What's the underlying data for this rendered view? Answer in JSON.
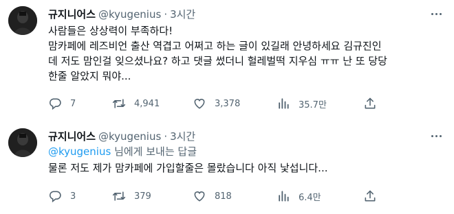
{
  "tweets": [
    {
      "name": "규지니어스",
      "handle": "@kyugenius",
      "sep": "·",
      "time": "3시간",
      "lines": [
        "사람들은 상상력이 부족하다!",
        "맘카페에 레즈비언 출산 역겹고 어쩌고 하는 글이 있길래 안녕하세요 김규진인",
        "데 저도 맘인걸 잊으셨나요? 하고 댓글 썼더니 헐레벌떡 지우심 ㅠㅠ 난 또 당당",
        "한줄 알았지 뭐야..."
      ],
      "replies": "7",
      "retweets": "4,941",
      "likes": "3,378",
      "views": "35.7만"
    },
    {
      "name": "규지니어스",
      "handle": "@kyugenius",
      "sep": "·",
      "time": "3시간",
      "reply_mention": "@kyugenius",
      "reply_suffix": " 님에게 보내는 답글",
      "lines": [
        "물론 저도 제가 맘카페에 가입할줄은 몰랐습니다 아직 낯섭니다..."
      ],
      "replies": "3",
      "retweets": "379",
      "likes": "818",
      "views": "6.4만"
    }
  ],
  "icons": {
    "reply": "reply-icon",
    "retweet": "retweet-icon",
    "like": "heart-icon",
    "views": "views-icon",
    "share": "share-icon",
    "more": "more-icon"
  },
  "colors": {
    "text": "#0f1419",
    "secondary": "#536471",
    "link": "#1d9bf0"
  }
}
